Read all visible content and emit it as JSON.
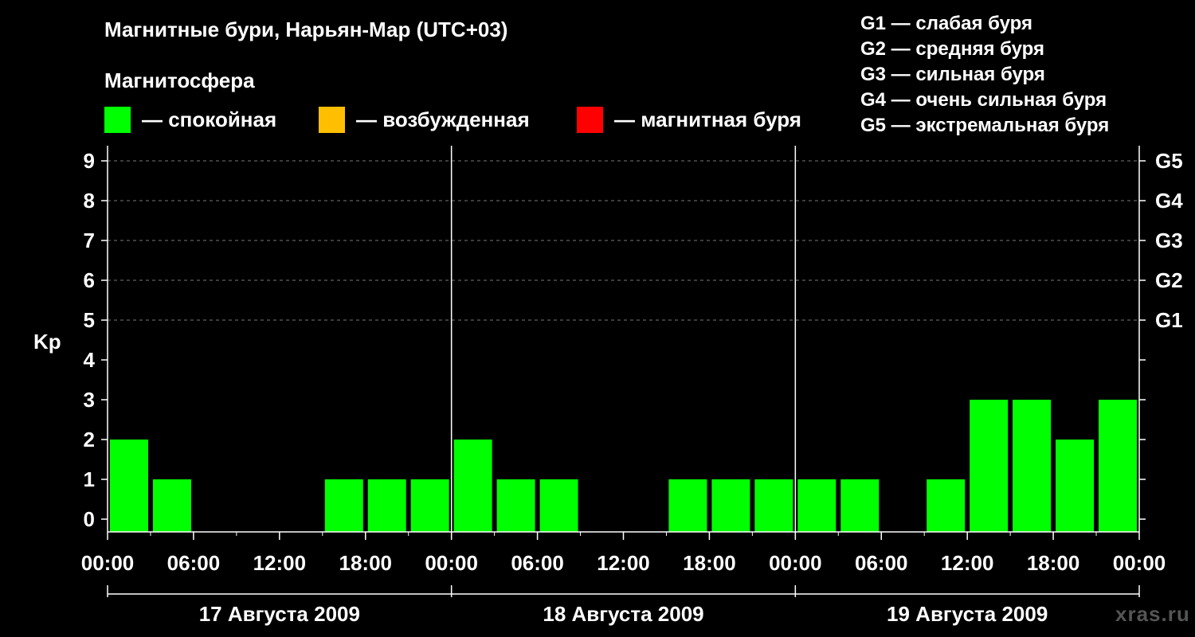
{
  "title": "Магнитные бури, Нарьян-Мар (UTC+03)",
  "subtitle": "Магнитосфера",
  "legend": [
    {
      "label": "— спокойная",
      "color": "#00ff00"
    },
    {
      "label": "— возбужденная",
      "color": "#ffbf00"
    },
    {
      "label": "— магнитная буря",
      "color": "#ff0000"
    }
  ],
  "g_scale": [
    "G1 — слабая буря",
    "G2 — средняя буря",
    "G3 — сильная буря",
    "G4 — очень сильная буря",
    "G5 — экстремальная буря"
  ],
  "watermark": "xras.ru",
  "chart_data": {
    "type": "bar",
    "ylabel": "Kp",
    "ylim": [
      0,
      9
    ],
    "yticks": [
      "0",
      "1",
      "2",
      "3",
      "4",
      "5",
      "6",
      "7",
      "8",
      "9"
    ],
    "right_axis_labels": [
      {
        "kp": 5,
        "label": "G1"
      },
      {
        "kp": 6,
        "label": "G2"
      },
      {
        "kp": 7,
        "label": "G3"
      },
      {
        "kp": 8,
        "label": "G4"
      },
      {
        "kp": 9,
        "label": "G5"
      }
    ],
    "x_tick_labels": [
      "00:00",
      "06:00",
      "12:00",
      "18:00",
      "00:00",
      "06:00",
      "12:00",
      "18:00",
      "00:00",
      "06:00",
      "12:00",
      "18:00",
      "00:00"
    ],
    "days": [
      "17 Августа 2009",
      "18 Августа 2009",
      "19 Августа 2009"
    ],
    "interval_hours": 3,
    "values": [
      2,
      1,
      0,
      0,
      0,
      1,
      1,
      1,
      2,
      1,
      1,
      0,
      0,
      1,
      1,
      1,
      1,
      1,
      0,
      1,
      3,
      3,
      2,
      3
    ],
    "colors": {
      "quiet": "#00ff00",
      "active": "#ffbf00",
      "storm": "#ff0000"
    },
    "grid": "dashed horizontal lines at Kp 5–9"
  }
}
